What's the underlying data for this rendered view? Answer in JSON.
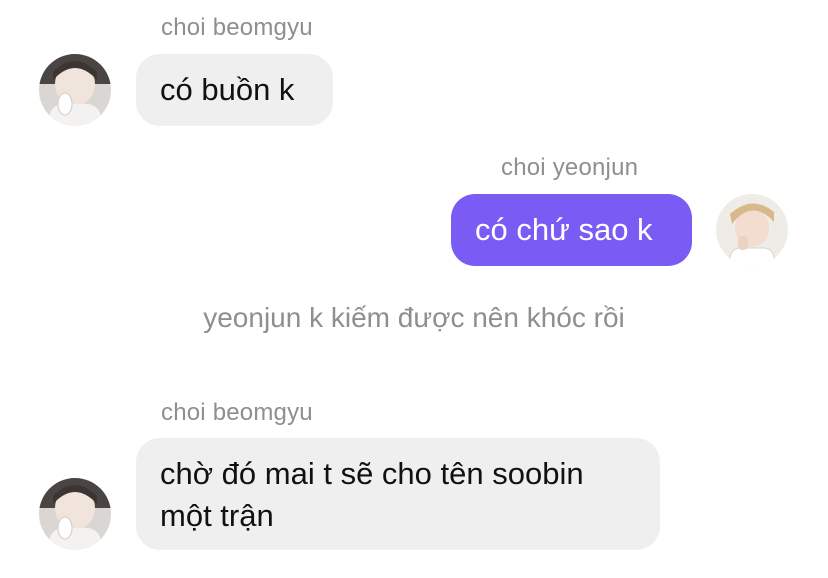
{
  "messages": [
    {
      "sender": "choi beomgyu",
      "text": "có buồn k",
      "direction": "incoming",
      "avatar": "beomgyu-avatar"
    },
    {
      "sender": "choi yeonjun",
      "text": "có chứ sao k",
      "direction": "outgoing",
      "avatar": "yeonjun-avatar"
    },
    {
      "sender": "choi beomgyu",
      "line1": "chờ đó mai t sẽ cho tên soobin",
      "line2": "một trận",
      "direction": "incoming",
      "avatar": "beomgyu-avatar"
    }
  ],
  "system_note": "yeonjun k kiếm được nên khóc rồi",
  "colors": {
    "outgoing_bubble": "#7a5cf5",
    "incoming_bubble": "#efeff0",
    "meta_text": "#8e8e93"
  }
}
